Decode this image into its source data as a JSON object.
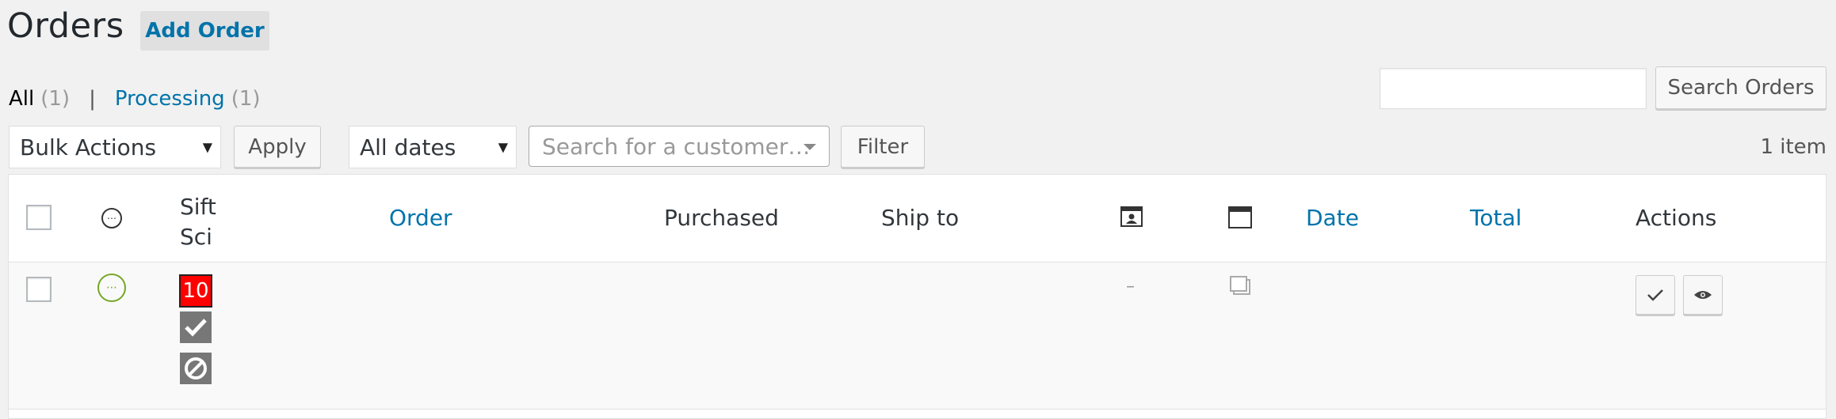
{
  "header": {
    "title": "Orders",
    "add_button": "Add Order"
  },
  "views": {
    "all_label": "All",
    "all_count": "(1)",
    "separator": "|",
    "processing_label": "Processing",
    "processing_count": "(1)"
  },
  "search": {
    "input_value": "",
    "button_label": "Search Orders"
  },
  "controls": {
    "bulk_actions_selected": "Bulk Actions",
    "apply_label": "Apply",
    "dates_selected": "All dates",
    "customer_placeholder": "Search for a customer…",
    "filter_label": "Filter",
    "item_count": "1 item"
  },
  "table": {
    "columns": {
      "sift_science_line1": "Sift",
      "sift_science_line2": "Sci",
      "order": "Order",
      "purchased": "Purchased",
      "ship_to": "Ship to",
      "date": "Date",
      "total": "Total",
      "actions": "Actions"
    },
    "rows": [
      {
        "sift_score": "10",
        "customer_message": "–"
      }
    ]
  },
  "colors": {
    "link": "#0073aa",
    "score_bg": "#ff0000",
    "status_processing": "#73a724"
  },
  "icons": {
    "status_header": "status-circle-icon",
    "customer_message_header": "customer-message-icon",
    "order_notes_header": "order-notes-icon",
    "row_status": "processing-status-icon",
    "sift_good": "checkmark-icon",
    "sift_bad": "ban-icon",
    "order_notes_row": "order-notes-icon",
    "action_complete": "checkmark-icon",
    "action_view": "eye-icon"
  }
}
